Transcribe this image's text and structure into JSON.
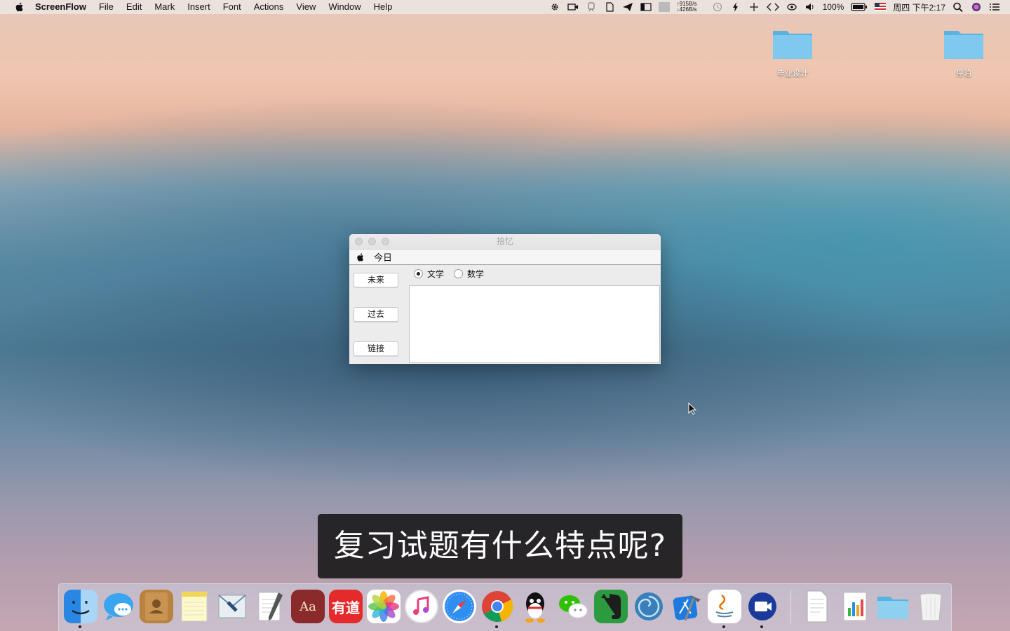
{
  "menubar": {
    "app_name": "ScreenFlow",
    "items": [
      "File",
      "Edit",
      "Mark",
      "Insert",
      "Font",
      "Actions",
      "View",
      "Window",
      "Help"
    ],
    "net_up": "↑915B/s",
    "net_down": "↓426B/s",
    "battery": "100%",
    "clock": "周四 下午2:17"
  },
  "desktop": {
    "icons": [
      {
        "label": "毕业设计",
        "icon": "folder-icon"
      },
      {
        "label": "停泊",
        "icon": "folder-icon"
      }
    ]
  },
  "window": {
    "title": "拾忆",
    "menu_label": "今日",
    "buttons": [
      "未来",
      "过去",
      "链接"
    ],
    "radios": [
      {
        "label": "文学",
        "selected": true
      },
      {
        "label": "数学",
        "selected": false
      }
    ],
    "text_content": ""
  },
  "subtitle": "复习试题有什么特点呢?",
  "dock": {
    "apps": [
      "finder-icon",
      "messages-icon",
      "contacts-icon",
      "notes-icon",
      "mail-icon",
      "textedit-icon",
      "dictionary-icon",
      "youdao-icon",
      "photos-icon",
      "itunes-icon",
      "safari-icon",
      "chrome-icon",
      "qq-icon",
      "wechat-icon",
      "evernote-icon",
      "launcher-icon",
      "xcode-icon",
      "java-icon",
      "screenflow-icon"
    ],
    "youdao_label": "有道",
    "dictionary_label": "Aa",
    "right_items": [
      "document-icon",
      "numbers-icon",
      "folder-stack-icon",
      "trash-icon"
    ]
  }
}
